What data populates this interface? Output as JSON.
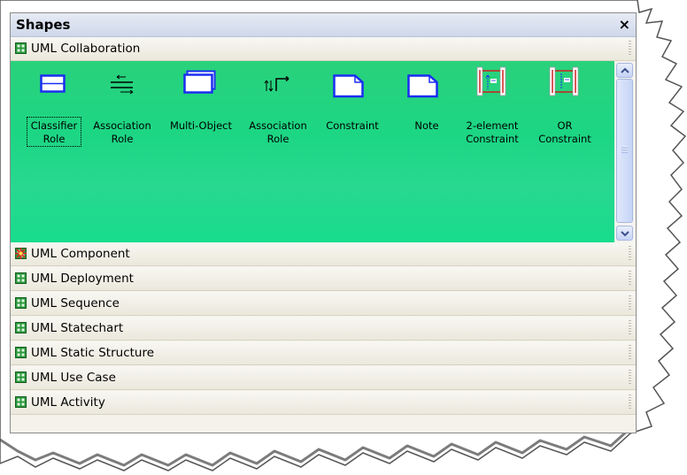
{
  "window": {
    "title": "Shapes",
    "close_glyph": "×"
  },
  "active_stencil": {
    "label": "UML Collaboration",
    "icon": "stencil-icon",
    "shapes": [
      {
        "label_line1": "Classifier",
        "label_line2": "Role",
        "icon": "classifier-role-icon",
        "selected": true
      },
      {
        "label_line1": "Association",
        "label_line2": "Role",
        "icon": "association-role-icon"
      },
      {
        "label_line1": "Multi-Object",
        "label_line2": "",
        "icon": "multi-object-icon"
      },
      {
        "label_line1": "Association",
        "label_line2": "Role",
        "icon": "association-role-2-icon"
      },
      {
        "label_line1": "Constraint",
        "label_line2": "",
        "icon": "constraint-icon"
      },
      {
        "label_line1": "Note",
        "label_line2": "",
        "icon": "note-icon"
      },
      {
        "label_line1": "2-element",
        "label_line2": "Constraint",
        "icon": "two-element-constraint-icon"
      },
      {
        "label_line1": "OR",
        "label_line2": "Constraint",
        "icon": "or-constraint-icon"
      }
    ]
  },
  "other_stencils": [
    {
      "label": "UML Component",
      "icon": "component-stencil-icon"
    },
    {
      "label": "UML Deployment",
      "icon": "stencil-icon"
    },
    {
      "label": "UML Sequence",
      "icon": "stencil-icon"
    },
    {
      "label": "UML Statechart",
      "icon": "stencil-icon"
    },
    {
      "label": "UML Static Structure",
      "icon": "stencil-icon"
    },
    {
      "label": "UML Use Case",
      "icon": "stencil-icon"
    },
    {
      "label": "UML Activity",
      "icon": "stencil-icon"
    }
  ],
  "colors": {
    "shapes_background": "#1cd684",
    "stencil_icon": "#2b9a3c",
    "icon_blue": "#1a2ef0"
  }
}
